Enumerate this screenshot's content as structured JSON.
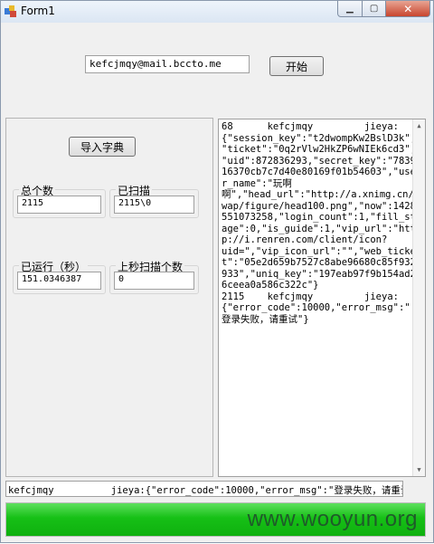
{
  "window": {
    "title": "Form1",
    "minimize_glyph": "▁",
    "maximize_glyph": "▢",
    "close_glyph": "✕"
  },
  "top": {
    "email_value": "kefcjmqy@mail.bccto.me",
    "start_label": "开始"
  },
  "left_panel": {
    "import_dict_label": "导入字典",
    "total_count_label": "总个数",
    "total_count_value": "2115",
    "scanned_label": "已扫描",
    "scanned_value": "2115\\0",
    "runtime_label": "已运行（秒）",
    "runtime_value": "151.0346387",
    "last_second_label": "上秒扫描个数",
    "last_second_value": "0"
  },
  "log": {
    "lines": [
      "68      kefcjmqy         jieya:",
      "{\"session_key\":\"t2dwompKw2BslD3k\",",
      "\"ticket\":\"0q2rVlw2HkZP6wNIEk6cd3\",",
      "\"uid\":872836293,\"secret_key\":\"7839",
      "16370cb7c7d40e80169f01b54603\",\"use",
      "r_name\":\"玩啊",
      "啊\",\"head_url\":\"http://a.xnimg.cn/",
      "wap/figure/head100.png\",\"now\":1428",
      "551073258,\"login_count\":1,\"fill_st",
      "age\":0,\"is_guide\":1,\"vip_url\":\"htt",
      "p://i.renren.com/client/icon?",
      "uid=\",\"vip_icon_url\":\"\",\"web_ticke",
      "t\":\"05e2d659b7527c8abe96680c85f932",
      "933\",\"uniq_key\":\"197eab97f9b154ad2",
      "6ceea0a586c322c\"}",
      "2115    kefcjmqy         jieya:",
      "{\"error_code\":10000,\"error_msg\":\"",
      "登录失败，请重试\"}"
    ]
  },
  "status": {
    "text": "kefcjmqy          jieya:{\"error_code\":10000,\"error_msg\":\"登录失败，请重试\"}"
  },
  "progress": {
    "fraction": 1.0,
    "fill_color": "#16c016"
  },
  "watermark": {
    "text": "www.wooyun.org"
  }
}
